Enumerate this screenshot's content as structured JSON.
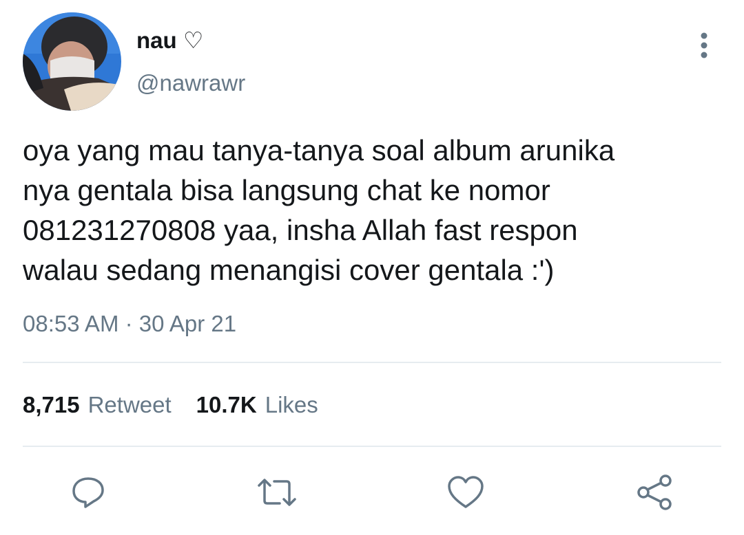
{
  "user": {
    "display_name": "nau ♡",
    "handle": "@nawrawr"
  },
  "tweet": {
    "text": "oya yang mau tanya-tanya soal album arunika\nnya gentala bisa langsung chat ke nomor\n081231270808 yaa, insha Allah fast respon\nwalau sedang menangisi cover gentala :')",
    "time": "08:53 AM",
    "separator": "·",
    "date": "30 Apr 21"
  },
  "stats": {
    "retweets_count": "8,715",
    "retweets_label": "Retweet",
    "likes_count": "10.7K",
    "likes_label": "Likes"
  },
  "icons": {
    "more": "more-vertical-icon",
    "reply": "reply-icon",
    "retweet": "retweet-icon",
    "like": "heart-icon",
    "share": "share-icon"
  },
  "colors": {
    "text": "#14171a",
    "secondary": "#657786",
    "divider": "#e6ecf0"
  }
}
